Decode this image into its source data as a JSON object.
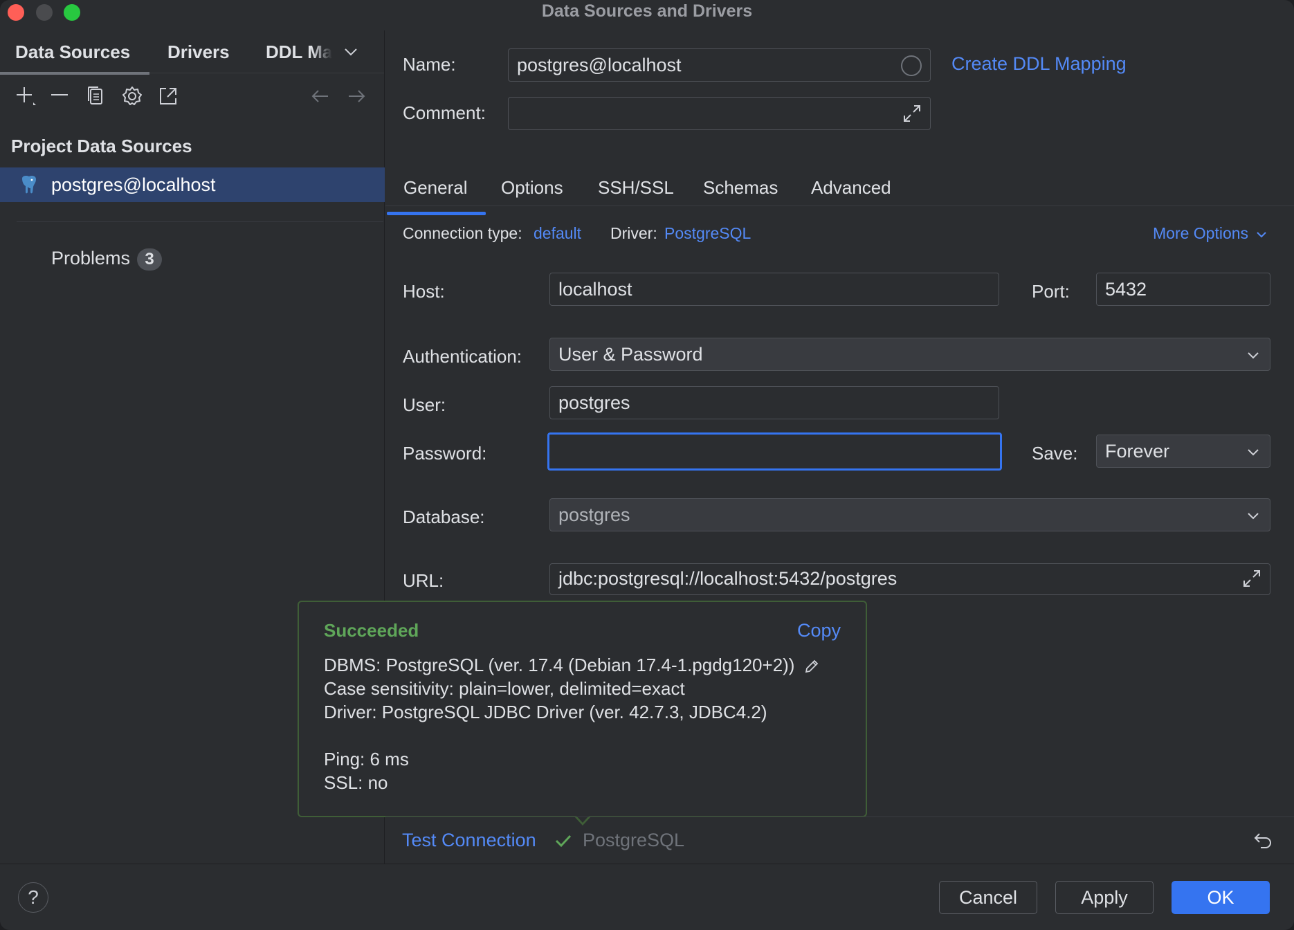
{
  "window": {
    "title": "Data Sources and Drivers"
  },
  "sidebar": {
    "tabs": [
      "Data Sources",
      "Drivers",
      "DDL Ma"
    ],
    "toolbar_icons": [
      "add-icon",
      "remove-icon",
      "duplicate-icon",
      "settings-icon",
      "jump-icon",
      "back-arrow-icon",
      "forward-arrow-icon"
    ],
    "section_title": "Project Data Sources",
    "items": [
      {
        "label": "postgres@localhost",
        "icon": "postgresql-elephant-icon"
      }
    ],
    "problems": {
      "label": "Problems",
      "count": "3"
    }
  },
  "main": {
    "name_label": "Name:",
    "name_value": "postgres@localhost",
    "create_ddl_link": "Create DDL Mapping",
    "comment_label": "Comment:",
    "comment_value": "",
    "tabs": [
      "General",
      "Options",
      "SSH/SSL",
      "Schemas",
      "Advanced"
    ],
    "active_tab": "General",
    "connection_type_label": "Connection type:",
    "connection_type_value": "default",
    "driver_label": "Driver:",
    "driver_value": "PostgreSQL",
    "more_options": "More Options",
    "host_label": "Host:",
    "host_value": "localhost",
    "port_label": "Port:",
    "port_value": "5432",
    "auth_label": "Authentication:",
    "auth_value": "User & Password",
    "user_label": "User:",
    "user_value": "postgres",
    "password_label": "Password:",
    "password_value": "",
    "save_label": "Save:",
    "save_value": "Forever",
    "database_label": "Database:",
    "database_value": "postgres",
    "url_label": "URL:",
    "url_value": "jdbc:postgresql://localhost:5432/postgres"
  },
  "popup": {
    "status": "Succeeded",
    "copy": "Copy",
    "dbms": "DBMS: PostgreSQL (ver. 17.4 (Debian 17.4-1.pgdg120+2))",
    "case_sensitivity": "Case sensitivity: plain=lower, delimited=exact",
    "driver": "Driver: PostgreSQL JDBC Driver (ver. 42.7.3, JDBC4.2)",
    "ping": "Ping: 6 ms",
    "ssl": "SSL: no"
  },
  "footer": {
    "test_connection": "Test Connection",
    "test_driver": "PostgreSQL"
  },
  "buttons": {
    "cancel": "Cancel",
    "apply": "Apply",
    "ok": "OK",
    "help": "?"
  },
  "colors": {
    "accent": "#3574f0",
    "link": "#548af7",
    "success": "#5fa659",
    "selection": "#2e436e"
  }
}
